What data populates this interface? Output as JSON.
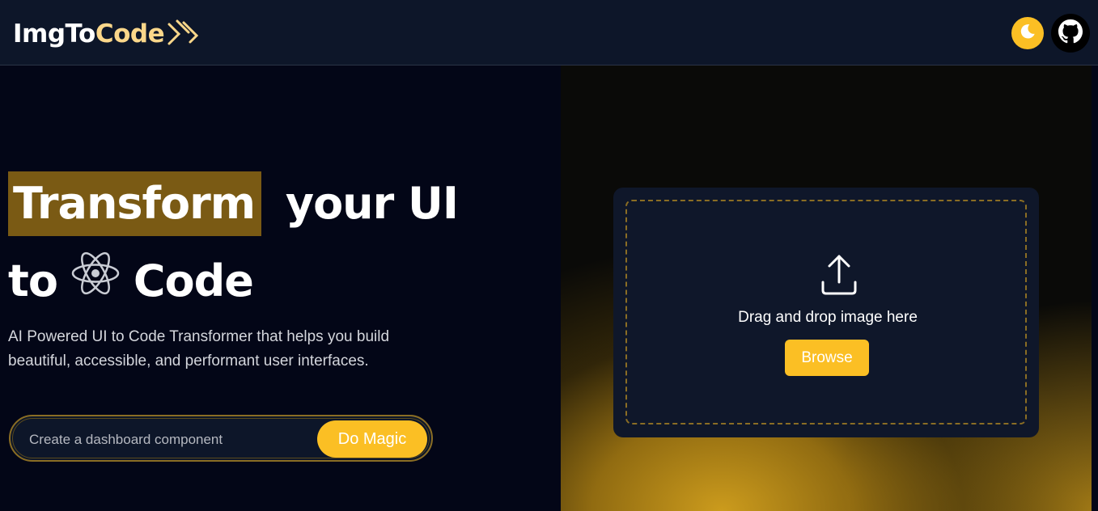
{
  "header": {
    "logo_prefix": "ImgTo",
    "logo_suffix": "Code",
    "theme_toggle_icon": "moon-icon",
    "github_icon": "github-icon"
  },
  "hero": {
    "title_highlight": "Transform",
    "title_rest": "your UI",
    "title_line2_start": "to",
    "title_line2_end": "Code",
    "title_icon": "react-icon",
    "subtitle": "AI Powered UI to Code Transformer that helps you build beautiful, accessible, and performant user interfaces."
  },
  "prompt": {
    "placeholder": "Create a dashboard component",
    "value": "",
    "button_label": "Do Magic"
  },
  "upload": {
    "icon": "upload-icon",
    "instruction": "Drag and drop image here",
    "browse_label": "Browse"
  },
  "colors": {
    "accent": "#fbbf24",
    "highlight": "#7a5a14",
    "logo_code": "#fbd78a",
    "header_bg": "#0d1629",
    "page_bg": "#030617"
  }
}
